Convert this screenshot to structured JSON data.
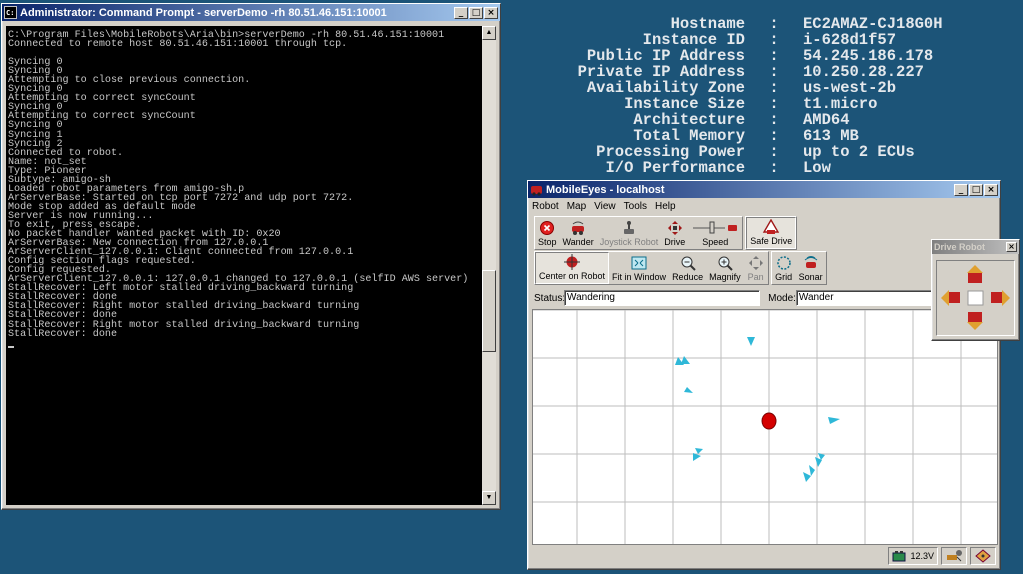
{
  "sysinfo": [
    {
      "label": "Hostname",
      "value": "EC2AMAZ-CJ18G0H"
    },
    {
      "label": "Instance ID",
      "value": "i-628d1f57"
    },
    {
      "label": "Public IP Address",
      "value": "54.245.186.178"
    },
    {
      "label": "Private IP Address",
      "value": "10.250.28.227"
    },
    {
      "label": "Availability Zone",
      "value": "us-west-2b"
    },
    {
      "label": "Instance Size",
      "value": "t1.micro"
    },
    {
      "label": "Architecture",
      "value": "AMD64"
    },
    {
      "label": "Total Memory",
      "value": "613 MB"
    },
    {
      "label": "Processing Power",
      "value": "up to 2 ECUs"
    },
    {
      "label": "I/O Performance",
      "value": "Low"
    }
  ],
  "sysinfo_separator": ":",
  "cmd": {
    "title": "Administrator: Command Prompt - serverDemo  -rh 80.51.46.151:10001",
    "lines": [
      "C:\\Program Files\\MobileRobots\\Aria\\bin>serverDemo -rh 80.51.46.151:10001",
      "Connected to remote host 80.51.46.151:10001 through tcp.",
      "",
      "Syncing 0",
      "Syncing 0",
      "Attempting to close previous connection.",
      "Syncing 0",
      "Attempting to correct syncCount",
      "Syncing 0",
      "Attempting to correct syncCount",
      "Syncing 0",
      "Syncing 1",
      "Syncing 2",
      "Connected to robot.",
      "Name: not_set",
      "Type: Pioneer",
      "Subtype: amigo-sh",
      "Loaded robot parameters from amigo-sh.p",
      "ArServerBase: Started on tcp port 7272 and udp port 7272.",
      "Mode stop added as default mode",
      "Server is now running...",
      "To exit, press escape.",
      "No packet handler wanted packet with ID: 0x20",
      "ArServerBase: New connection from 127.0.0.1",
      "ArServerClient_127.0.0.1: Client connected from 127.0.0.1",
      "Config section flags requested.",
      "Config requested.",
      "ArServerClient_127.0.0.1: 127.0.0.1 changed to 127.0.0.1 (selfID AWS server)",
      "StallRecover: Left motor stalled driving_backward turning",
      "StallRecover: done",
      "StallRecover: Right motor stalled driving_backward turning",
      "StallRecover: done",
      "StallRecover: Right motor stalled driving_backward turning",
      "StallRecover: done"
    ],
    "scroll_position": 0.62
  },
  "mobileeyes": {
    "title": "MobileEyes - localhost",
    "menu": [
      "Robot",
      "Map",
      "View",
      "Tools",
      "Help"
    ],
    "toolbar1": {
      "stop": "Stop",
      "wander": "Wander",
      "joystick": "Joystick Robot",
      "drive": "Drive",
      "speed": "Speed",
      "safe_drive": "Safe Drive"
    },
    "toolbar2": {
      "center": "Center on Robot",
      "fit": "Fit in Window",
      "reduce": "Reduce",
      "magnify": "Magnify",
      "pan": "Pan",
      "grid": "Grid",
      "sonar": "Sonar"
    },
    "status_label": "Status:",
    "status_value": "Wandering",
    "mode_label": "Mode:",
    "mode_value": "Wander",
    "battery": "12.3V",
    "colors": {
      "robot": "#d40000",
      "sonar": "#2fb8d8",
      "grid": "#bdbdbd"
    }
  },
  "drive_robot": {
    "title": "Drive Robot"
  }
}
